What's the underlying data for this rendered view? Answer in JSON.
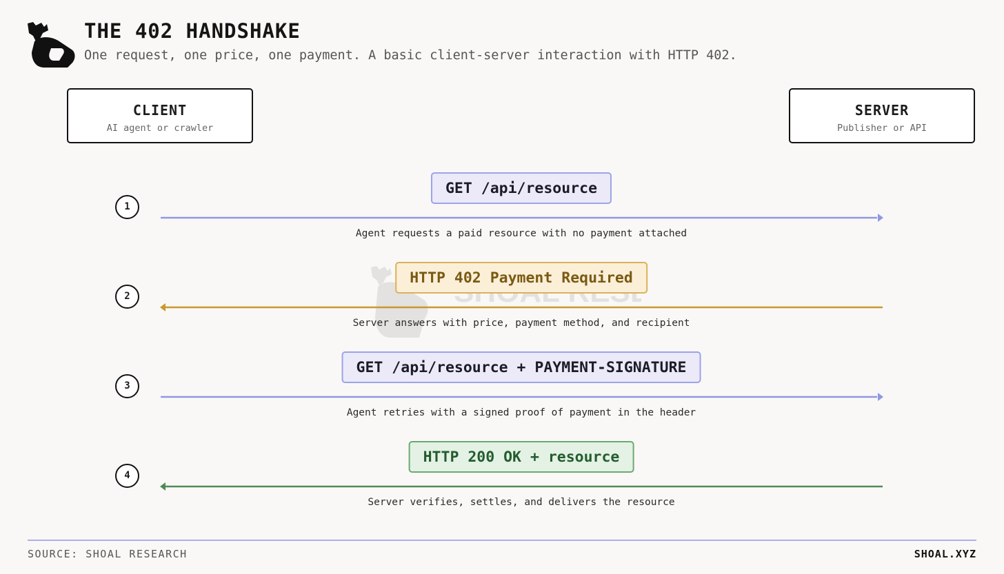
{
  "header": {
    "title": "THE 402 HANDSHAKE",
    "subtitle": "One request, one price, one payment. A basic client-server interaction with HTTP 402."
  },
  "client": {
    "name": "CLIENT",
    "description": "AI agent or crawler"
  },
  "server": {
    "name": "SERVER",
    "description": "Publisher or API"
  },
  "watermark": {
    "text": "SHOAL RESEARCH"
  },
  "steps": [
    {
      "number": "1",
      "message": "GET /api/resource",
      "description": "Agent requests a paid resource with no payment attached",
      "direction": "client-to-server",
      "color": "#8f97e6"
    },
    {
      "number": "2",
      "message": "HTTP 402 Payment Required",
      "description": "Server answers with price, payment method, and recipient",
      "direction": "server-to-client",
      "color": "#c9992d"
    },
    {
      "number": "3",
      "message": "GET /api/resource + PAYMENT-SIGNATURE",
      "description": "Agent retries with a signed proof of payment in the header",
      "direction": "client-to-server",
      "color": "#8f97e6"
    },
    {
      "number": "4",
      "message": "HTTP 200 OK + resource",
      "description": "Server verifies, settles, and delivers the resource",
      "direction": "server-to-client",
      "color": "#4f8a56"
    }
  ],
  "footer": {
    "source": "SOURCE: SHOAL RESEARCH",
    "site": "SHOAL.XYZ"
  },
  "colors": {
    "background": "#faf8f6",
    "request": "#8f97e6",
    "payment_required": "#c9992d",
    "success": "#4f8a56"
  }
}
